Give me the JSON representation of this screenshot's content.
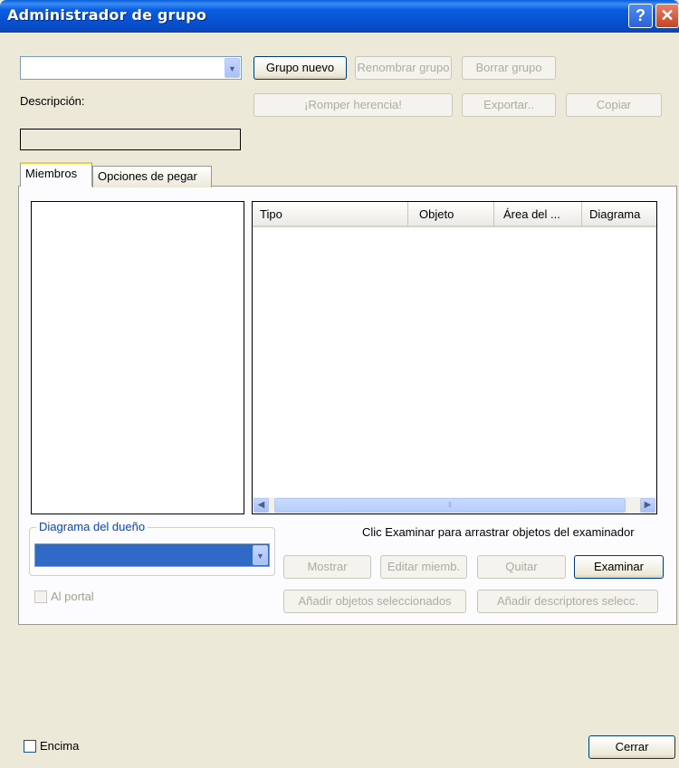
{
  "window": {
    "title": "Administrador de grupo",
    "help_glyph": "?",
    "close_glyph": "✕"
  },
  "top": {
    "group_combo_value": "",
    "buttons": {
      "new_group": "Grupo nuevo",
      "rename_group": "Renombrar grupo",
      "delete_group": "Borrar grupo",
      "break_inheritance": "¡Romper herencia!",
      "export": "Exportar..",
      "copy": "Copiar"
    },
    "description_label": "Descripción:",
    "description_value": ""
  },
  "tabs": [
    {
      "label": "Miembros",
      "active": true
    },
    {
      "label": "Opciones de pegar",
      "active": false
    }
  ],
  "objects_table": {
    "columns": [
      "Tipo",
      "Objeto",
      "Área del ...",
      "Diagrama"
    ],
    "rows": []
  },
  "owner_diagram": {
    "legend": "Diagrama del dueño",
    "selected": ""
  },
  "hint_text": "Clic Examinar para arrastrar objetos del examinador",
  "member_buttons": {
    "show": "Mostrar",
    "edit": "Editar miemb.",
    "remove": "Quitar",
    "browse": "Examinar",
    "add_selected_objects": "Añadir objetos seleccionados",
    "add_selected_descriptors": "Añadir descriptores selecc."
  },
  "checkboxes": {
    "portal": "Al portal",
    "on_top": "Encima"
  },
  "footer": {
    "close": "Cerrar"
  },
  "colors": {
    "titlebar": "#0a5fd8",
    "dialog_bg": "#ece9d8",
    "accent": "#0046d5",
    "tab_highlight": "#ffc83c"
  }
}
